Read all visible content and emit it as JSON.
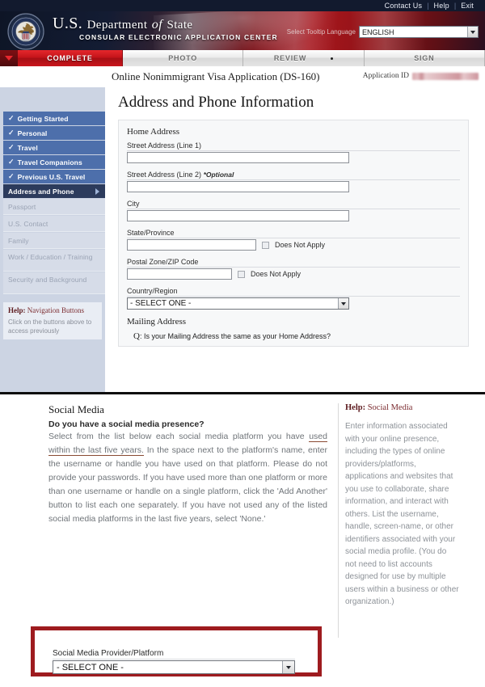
{
  "utility": {
    "links": [
      "Contact Us",
      "Help",
      "Exit"
    ]
  },
  "banner": {
    "title_us": "U.S.",
    "title_department": "Department",
    "title_of": "of",
    "title_state": "State",
    "subtitle": "CONSULAR ELECTRONIC APPLICATION CENTER",
    "language_label": "Select Tooltip Language",
    "language_value": "ENGLISH",
    "seal_name": "great-seal-of-the-united-states"
  },
  "tabs": [
    {
      "label": "COMPLETE",
      "active": true
    },
    {
      "label": "PHOTO",
      "active": false
    },
    {
      "label": "REVIEW",
      "active": false
    },
    {
      "label": "SIGN",
      "active": false
    }
  ],
  "document": {
    "title": "Online Nonimmigrant Visa Application (DS-160)",
    "application_id_label": "Application ID",
    "application_id_value": ""
  },
  "sidebar": {
    "items": [
      {
        "label": "Getting Started",
        "state": "done"
      },
      {
        "label": "Personal",
        "state": "done"
      },
      {
        "label": "Travel",
        "state": "done"
      },
      {
        "label": "Travel Companions",
        "state": "done"
      },
      {
        "label": "Previous U.S. Travel",
        "state": "done"
      },
      {
        "label": "Address and Phone",
        "state": "active"
      },
      {
        "label": "Passport",
        "state": "pending"
      },
      {
        "label": "U.S. Contact",
        "state": "pending"
      },
      {
        "label": "Family",
        "state": "pending"
      },
      {
        "label": "Work / Education / Training",
        "state": "pending"
      },
      {
        "label": "Security and Background",
        "state": "pending"
      }
    ],
    "help": {
      "title_bold": "Help:",
      "title_rest": " Navigation Buttons",
      "text": "Click on the buttons above to access previously"
    }
  },
  "page": {
    "heading": "Address and Phone Information",
    "home_address_heading": "Home Address",
    "fields": {
      "street1_label": "Street Address (Line 1)",
      "street1_value": "",
      "street2_label": "Street Address (Line 2) ",
      "street2_optional": "*Optional",
      "street2_value": "",
      "city_label": "City",
      "city_value": "",
      "state_label": "State/Province",
      "state_value": "",
      "state_dna_label": "Does Not Apply",
      "postal_label": "Postal Zone/ZIP Code",
      "postal_value": "",
      "postal_dna_label": "Does Not Apply",
      "country_label": "Country/Region",
      "country_value": "- SELECT ONE -"
    },
    "mailing_address_heading": "Mailing Address",
    "mailing_q_prefix": "Q",
    "mailing_question": ": Is your Mailing Address the same as your Home Address?"
  },
  "social_media": {
    "heading": "Social Media",
    "question": "Do you have a social media presence?",
    "paragraph_part1": "Select from the list below each social media platform you have ",
    "paragraph_underlined": "used within the last five years.",
    "paragraph_part2": " In the space next to the platform's name, enter the username or handle you have used on that platform. Please do not provide your passwords. If you have used more than one platform or more than one username or handle on a single platform, click the 'Add Another' button to list each one separately. If you have not used any of the listed social media platforms in the last five years, select 'None.'",
    "help_title_bold": "Help:",
    "help_title_rest": " Social Media",
    "help_text": "Enter information associated with your online presence, including the types of online providers/platforms, applications and websites that you use to collaborate, share information, and interact with others. List the username, handle, screen-name, or other identifiers associated with your social media profile. (You do not need to list accounts designed for use by multiple users within a business or other organization.)",
    "provider_label": "Social Media Provider/Platform",
    "provider_value": "- SELECT ONE -"
  },
  "colors": {
    "accent_red": "#c4141a",
    "highlight_border": "#9e1b1f",
    "nav_done": "#4d6fab",
    "nav_active": "#2c3b5c",
    "banner_dark": "#121a2e"
  }
}
